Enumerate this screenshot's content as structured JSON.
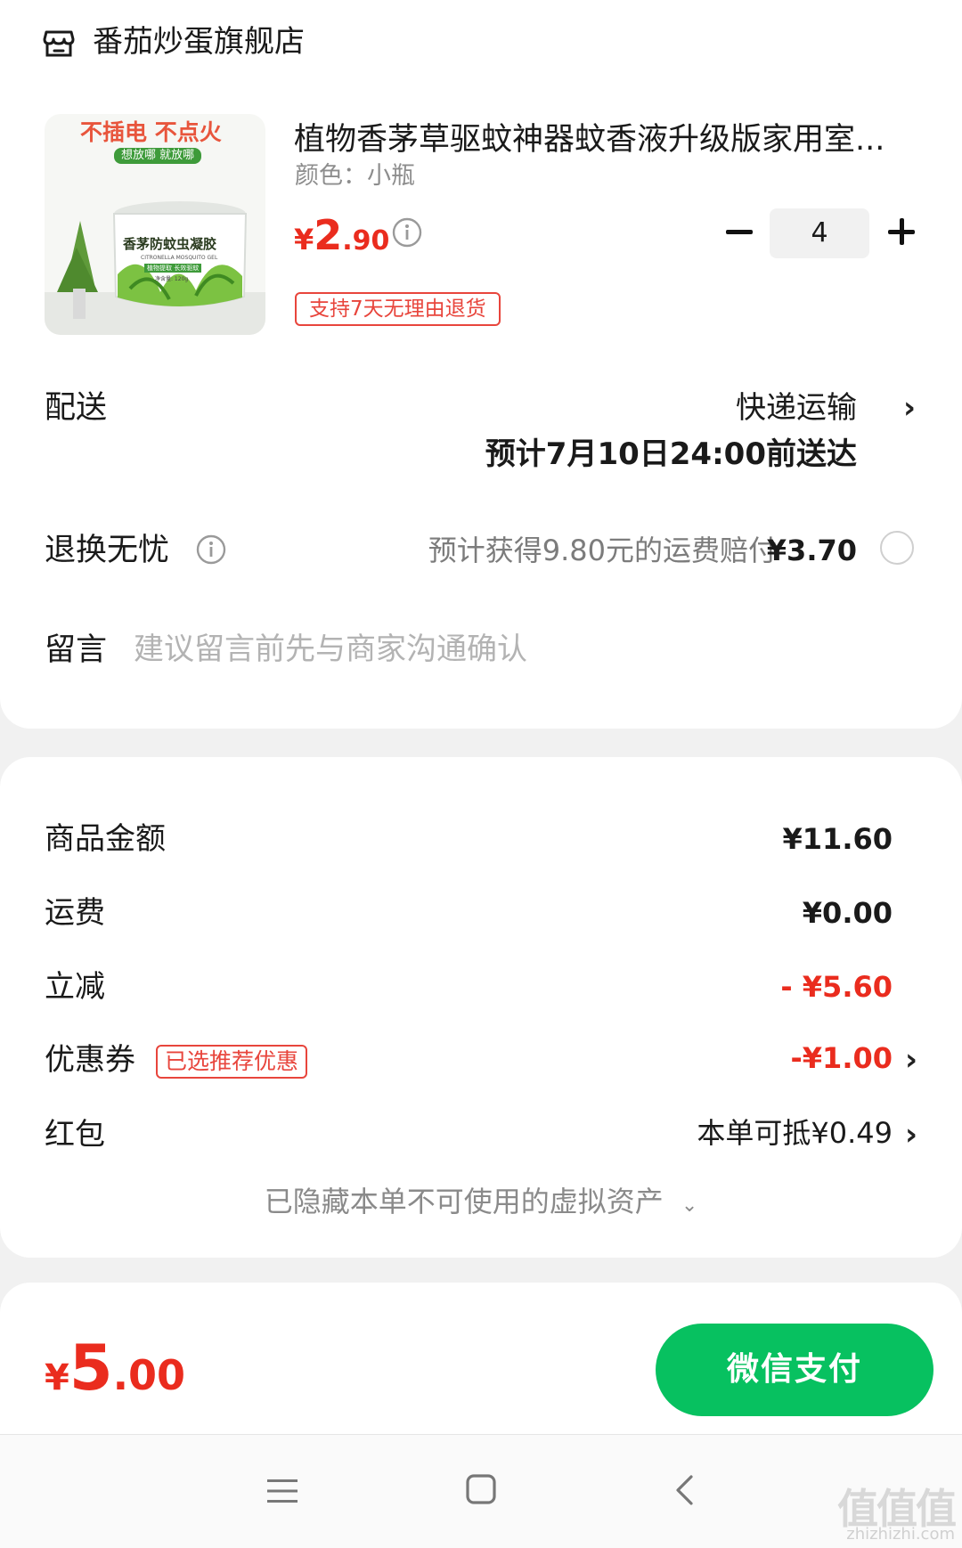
{
  "store": {
    "name": "番茄炒蛋旗舰店",
    "icon": "store-icon"
  },
  "product": {
    "title": "植物香茅草驱蚊神器蚊香液升级版家用室...",
    "spec": "颜色：小瓶",
    "price": {
      "currency": "¥",
      "integer": "2",
      "decimal": ".90"
    },
    "quantity": "4",
    "return_tag": "支持7天无理由退货",
    "image": {
      "banner": "不插电 不点火",
      "sub_banner": "想放哪 就放哪",
      "jar_label": "香茅防蚊虫凝胶",
      "jar_sub": "CITRONELLA MOSQUITO GEL",
      "jar_tag": "植物提取 长效驱蚊",
      "jar_weight": "净含量: 120g"
    }
  },
  "delivery": {
    "label": "配送",
    "method": "快递运输",
    "eta": "预计7月10日24:00前送达"
  },
  "return_insurance": {
    "label": "退换无忧",
    "desc": "预计获得9.80元的运费赔付",
    "price": "¥3.70",
    "selected": false
  },
  "message": {
    "label": "留言",
    "placeholder": "建议留言前先与商家沟通确认"
  },
  "summary": {
    "goods_label": "商品金额",
    "goods_value": "¥11.60",
    "shipping_label": "运费",
    "shipping_value": "¥0.00",
    "discount_label": "立减",
    "discount_value": "- ¥5.60",
    "coupon_label": "优惠券",
    "coupon_tag": "已选推荐优惠",
    "coupon_value": "-¥1.00",
    "redpacket_label": "红包",
    "redpacket_value": "本单可抵¥0.49",
    "hidden_assets": "已隐藏本单不可使用的虚拟资产"
  },
  "footer": {
    "total": {
      "currency": "¥",
      "integer": "5",
      "decimal": ".00"
    },
    "pay_button": "微信支付"
  },
  "watermark": {
    "text": "值值值",
    "sub": "zhizhizhi.com"
  },
  "colors": {
    "accent_red": "#ea2c1e",
    "wechat_green": "#07c160"
  }
}
